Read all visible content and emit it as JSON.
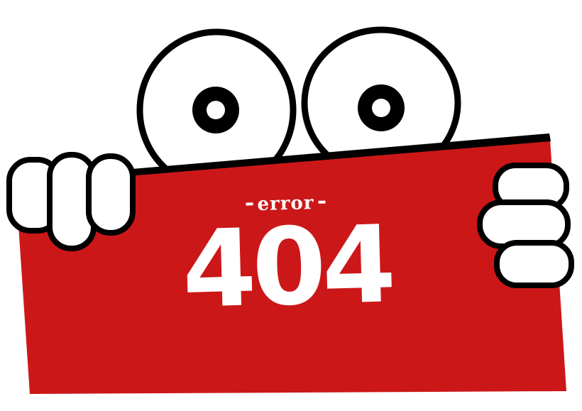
{
  "sign": {
    "prefix_dash": "-",
    "error_word": "error",
    "suffix_dash": "-",
    "code": "404"
  },
  "colors": {
    "sign_red": "#cc1719",
    "outline": "#000000",
    "white": "#ffffff"
  },
  "icons": [
    "left-eye-icon",
    "right-eye-icon",
    "left-hand-icon",
    "right-hand-icon"
  ]
}
